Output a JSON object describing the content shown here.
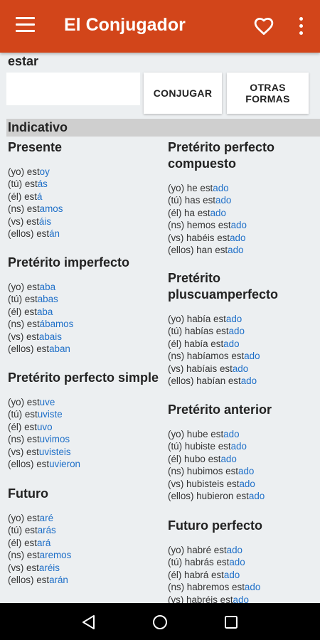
{
  "app": {
    "title": "El Conjugador"
  },
  "icons": {
    "menu": "hamburger-menu-icon",
    "favorite": "heart-outline-icon",
    "more": "more-vert-icon"
  },
  "colors": {
    "appbar": "#d2451a",
    "ending": "#1e6fc8",
    "mode_bar": "#cfcfcf"
  },
  "search": {
    "verb": "estar",
    "value": "",
    "placeholder": ""
  },
  "buttons": {
    "conjugar": "CONJUGAR",
    "otras_formas": "OTRAS FORMAS"
  },
  "mode": "Indicativo",
  "tenses_left": [
    {
      "name": "Presente",
      "rows": [
        {
          "p": "(yo) ",
          "s": "est",
          "e": "oy"
        },
        {
          "p": "(tú) ",
          "s": "est",
          "e": "ás"
        },
        {
          "p": "(él) ",
          "s": "est",
          "e": "á"
        },
        {
          "p": "(ns) ",
          "s": "est",
          "e": "amos"
        },
        {
          "p": "(vs) ",
          "s": "est",
          "e": "áis"
        },
        {
          "p": "(ellos) ",
          "s": "est",
          "e": "án"
        }
      ]
    },
    {
      "name": "Pretérito imperfecto",
      "rows": [
        {
          "p": "(yo) ",
          "s": "est",
          "e": "aba"
        },
        {
          "p": "(tú) ",
          "s": "est",
          "e": "abas"
        },
        {
          "p": "(él) ",
          "s": "est",
          "e": "aba"
        },
        {
          "p": "(ns) ",
          "s": "est",
          "e": "ábamos"
        },
        {
          "p": "(vs) ",
          "s": "est",
          "e": "abais"
        },
        {
          "p": "(ellos) ",
          "s": "est",
          "e": "aban"
        }
      ]
    },
    {
      "name": "Pretérito perfecto simple",
      "rows": [
        {
          "p": "(yo) ",
          "s": "est",
          "e": "uve"
        },
        {
          "p": "(tú) ",
          "s": "est",
          "e": "uviste"
        },
        {
          "p": "(él) ",
          "s": "est",
          "e": "uvo"
        },
        {
          "p": "(ns) ",
          "s": "est",
          "e": "uvimos"
        },
        {
          "p": "(vs) ",
          "s": "est",
          "e": "uvisteis"
        },
        {
          "p": "(ellos) ",
          "s": "est",
          "e": "uvieron"
        }
      ]
    },
    {
      "name": "Futuro",
      "rows": [
        {
          "p": "(yo) ",
          "s": "est",
          "e": "aré"
        },
        {
          "p": "(tú) ",
          "s": "est",
          "e": "arás"
        },
        {
          "p": "(él) ",
          "s": "est",
          "e": "ará"
        },
        {
          "p": "(ns) ",
          "s": "est",
          "e": "aremos"
        },
        {
          "p": "(vs) ",
          "s": "est",
          "e": "aréis"
        },
        {
          "p": "(ellos) ",
          "s": "est",
          "e": "arán"
        }
      ]
    }
  ],
  "tenses_right": [
    {
      "name": "Pretérito perfecto compuesto",
      "rows": [
        {
          "p": "(yo) he ",
          "s": "est",
          "e": "ado"
        },
        {
          "p": "(tú) has ",
          "s": "est",
          "e": "ado"
        },
        {
          "p": "(él) ha ",
          "s": "est",
          "e": "ado"
        },
        {
          "p": "(ns) hemos ",
          "s": "est",
          "e": "ado"
        },
        {
          "p": "(vs) habéis ",
          "s": "est",
          "e": "ado"
        },
        {
          "p": "(ellos) han ",
          "s": "est",
          "e": "ado"
        }
      ]
    },
    {
      "name": "Pretérito pluscuamperfecto",
      "rows": [
        {
          "p": "(yo) había ",
          "s": "est",
          "e": "ado"
        },
        {
          "p": "(tú) habías ",
          "s": "est",
          "e": "ado"
        },
        {
          "p": "(él) había ",
          "s": "est",
          "e": "ado"
        },
        {
          "p": "(ns) habíamos ",
          "s": "est",
          "e": "ado"
        },
        {
          "p": "(vs) habíais ",
          "s": "est",
          "e": "ado"
        },
        {
          "p": "(ellos) habían ",
          "s": "est",
          "e": "ado"
        }
      ]
    },
    {
      "name": "Pretérito anterior",
      "rows": [
        {
          "p": "(yo) hube ",
          "s": "est",
          "e": "ado"
        },
        {
          "p": "(tú) hubiste ",
          "s": "est",
          "e": "ado"
        },
        {
          "p": "(él) hubo ",
          "s": "est",
          "e": "ado"
        },
        {
          "p": "(ns) hubimos ",
          "s": "est",
          "e": "ado"
        },
        {
          "p": "(vs) hubisteis ",
          "s": "est",
          "e": "ado"
        },
        {
          "p": "(ellos) hubieron ",
          "s": "est",
          "e": "ado"
        }
      ]
    },
    {
      "name": "Futuro perfecto",
      "rows": [
        {
          "p": "(yo) habré ",
          "s": "est",
          "e": "ado"
        },
        {
          "p": "(tú) habrás ",
          "s": "est",
          "e": "ado"
        },
        {
          "p": "(él) habrá ",
          "s": "est",
          "e": "ado"
        },
        {
          "p": "(ns) habremos ",
          "s": "est",
          "e": "ado"
        },
        {
          "p": "(vs) habréis ",
          "s": "est",
          "e": "ado"
        }
      ]
    }
  ],
  "navbar": {
    "back": "back-triangle-icon",
    "home": "home-circle-icon",
    "recents": "recents-square-icon"
  }
}
